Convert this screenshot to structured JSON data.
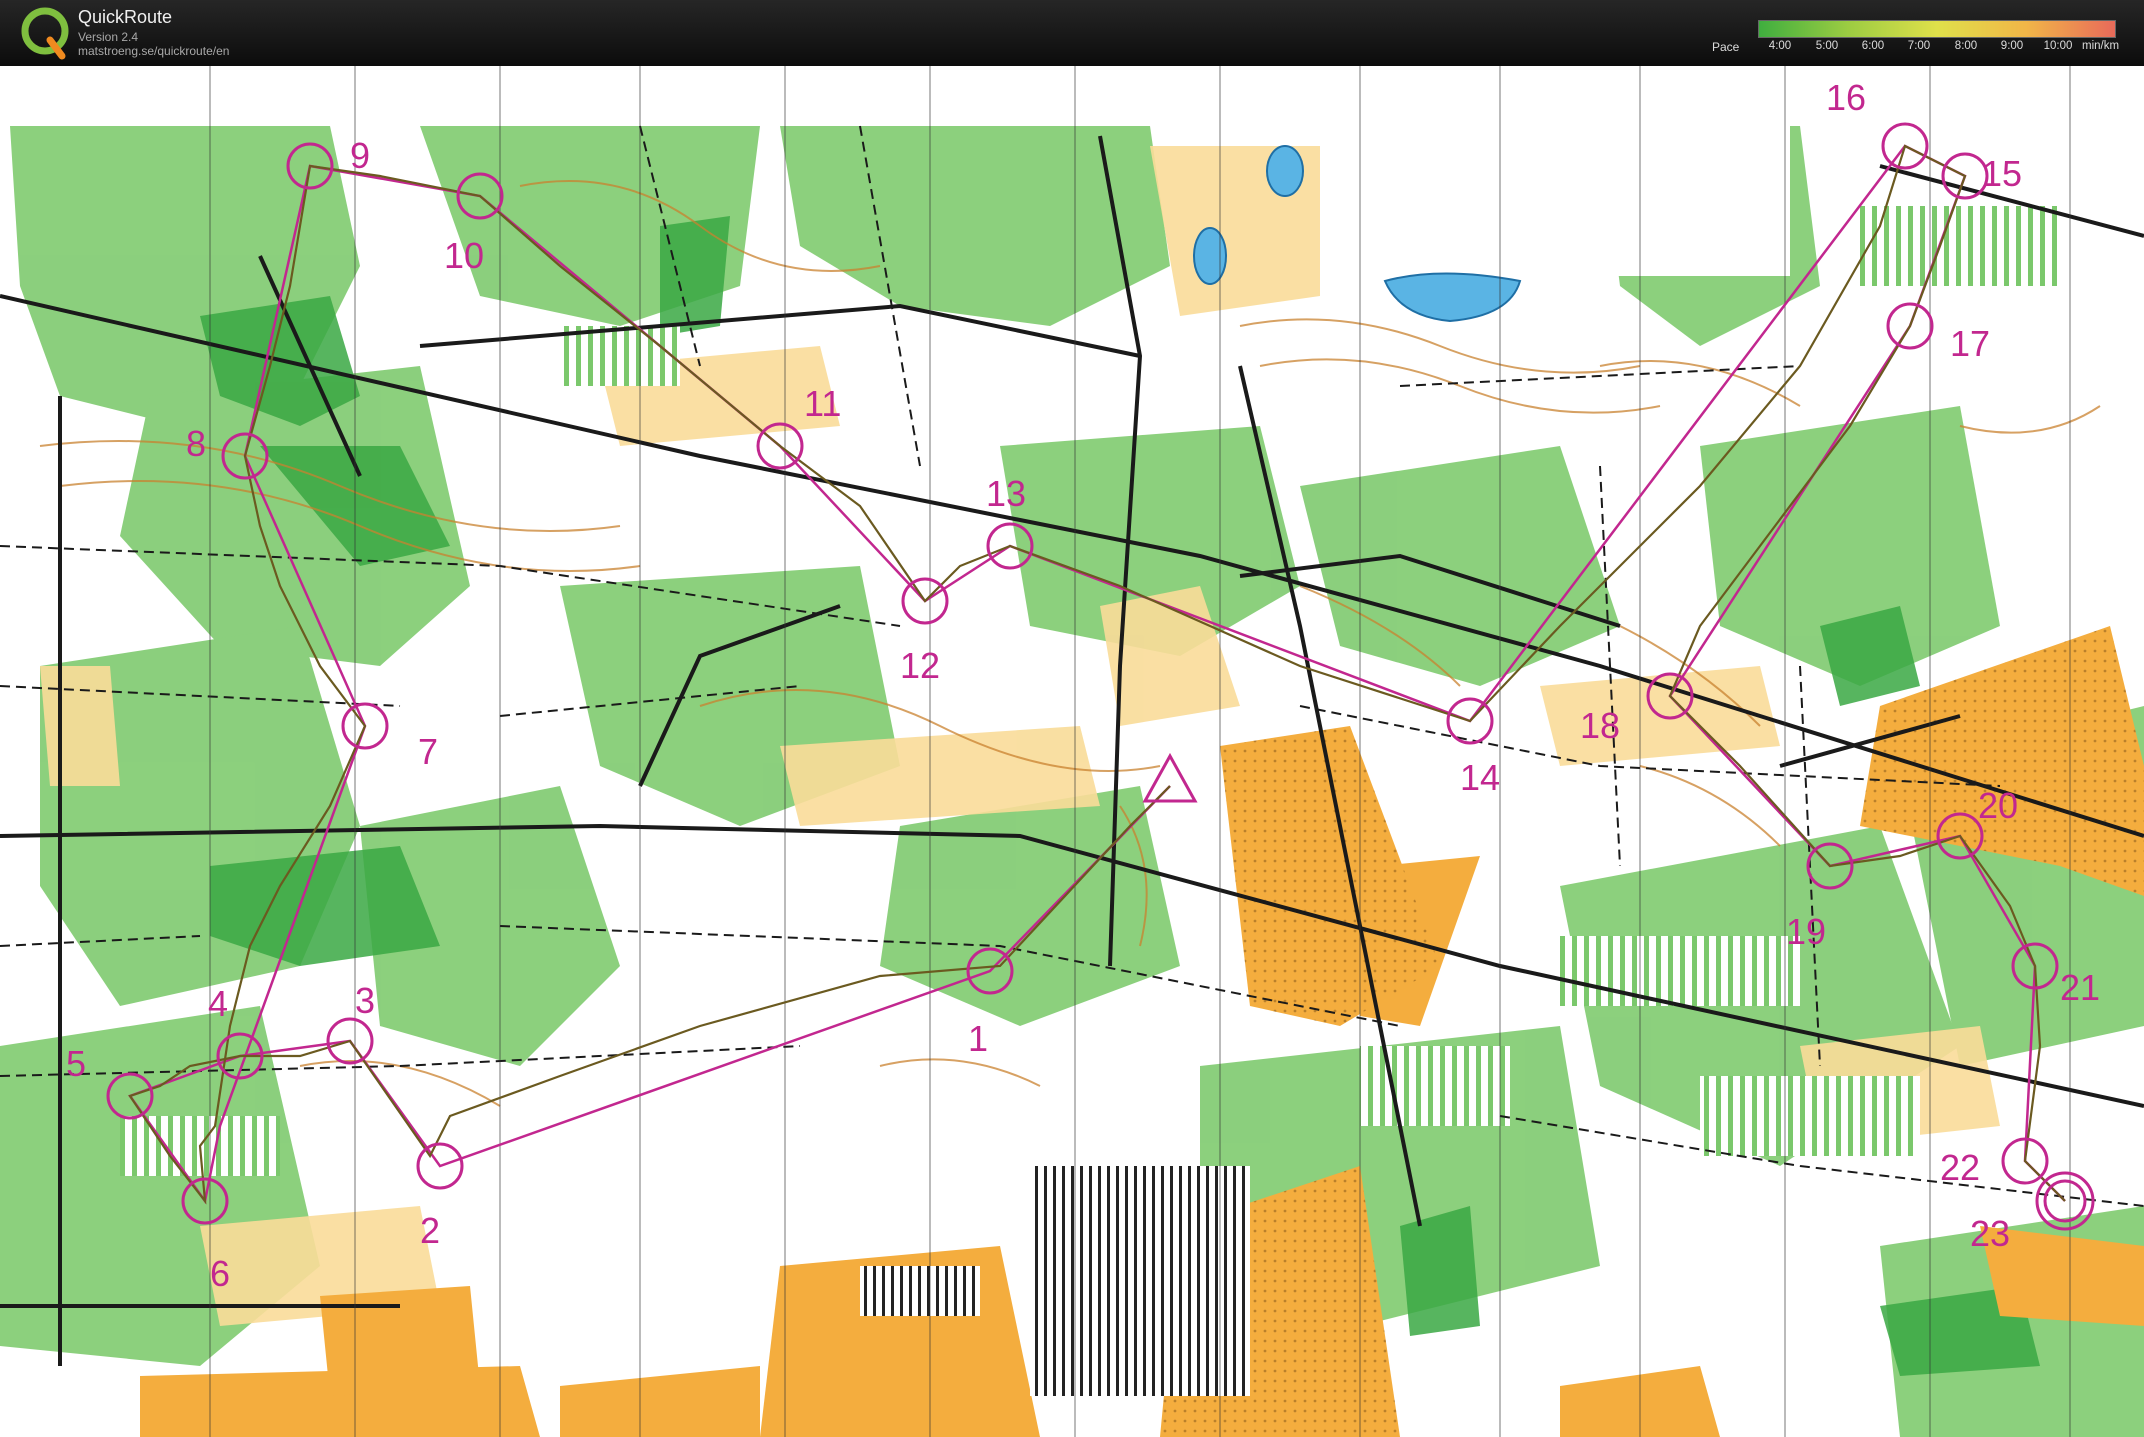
{
  "header": {
    "app_title": "QuickRoute",
    "version": "Version 2.4",
    "url": "matstroeng.se/quickroute/en",
    "logo_letter": "Q"
  },
  "pace_legend": {
    "label": "Pace",
    "ticks": [
      "4:00",
      "5:00",
      "6:00",
      "7:00",
      "8:00",
      "9:00",
      "10:00"
    ],
    "unit": "min/km",
    "gradient_colors": [
      "#3fae3f",
      "#9ccc42",
      "#dfe04a",
      "#f1b648",
      "#e86a5a"
    ]
  },
  "map": {
    "colors": {
      "forest": "#7bc86c",
      "dense_forest": "#38a73e",
      "open_land": "#f2a93b",
      "rough_open": "#f8db95",
      "contour": "#c9822f",
      "course": "#c2278f",
      "route": "#6b5a20",
      "water": "#5ab4e4"
    },
    "controls": [
      {
        "number": "1"
      },
      {
        "number": "2"
      },
      {
        "number": "3"
      },
      {
        "number": "4"
      },
      {
        "number": "5"
      },
      {
        "number": "6"
      },
      {
        "number": "7"
      },
      {
        "number": "8"
      },
      {
        "number": "9"
      },
      {
        "number": "10"
      },
      {
        "number": "11"
      },
      {
        "number": "12"
      },
      {
        "number": "13"
      },
      {
        "number": "14"
      },
      {
        "number": "15"
      },
      {
        "number": "16"
      },
      {
        "number": "17"
      },
      {
        "number": "18"
      },
      {
        "number": "19"
      },
      {
        "number": "20"
      },
      {
        "number": "21"
      },
      {
        "number": "22"
      },
      {
        "number": "23"
      }
    ]
  }
}
